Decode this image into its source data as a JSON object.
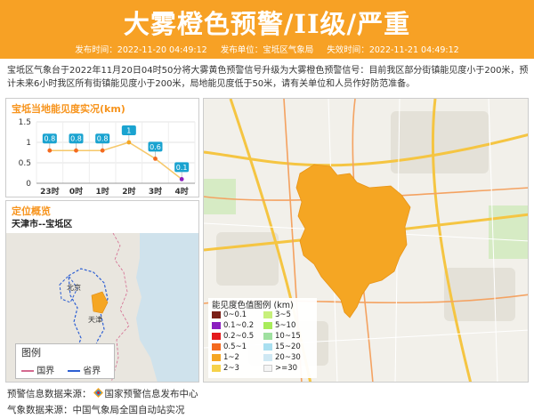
{
  "header": {
    "title": "大雾橙色预警/II级/严重",
    "publish_time_label": "发布时间：",
    "publish_time": "2022-11-20 04:49:12",
    "publisher_label": "发布单位：",
    "publisher": "宝坻区气象局",
    "expire_time_label": "失效时间：",
    "expire_time": "2022-11-21 04:49:12"
  },
  "description": "宝坻区气象台于2022年11月20日04时50分将大雾黄色预警信号升级为大雾橙色预警信号：目前我区部分街镇能见度小于200米，预计未来6小时我区所有街镇能见度小于200米，局地能见度低于50米，请有关单位和人员作好防范准备。",
  "visibility_panel": {
    "title": "宝坻当地能见度实况(km)"
  },
  "location_panel": {
    "title": "定位概览",
    "subtitle": "天津市--宝坻区",
    "map_labels": {
      "beijing": "北京",
      "tianjin": "天津"
    },
    "legend_title": "图例",
    "legend_items": [
      {
        "label": "国界",
        "color": "#d46a8f"
      },
      {
        "label": "省界",
        "color": "#2d5fd3"
      }
    ]
  },
  "visibility_legend": {
    "title": "能见度色值图例 (km)",
    "items": [
      {
        "label": "0~0.1",
        "color": "#7a1f16"
      },
      {
        "label": "3~5",
        "color": "#c7f07a"
      },
      {
        "label": "0.1~0.2",
        "color": "#8b1fbf"
      },
      {
        "label": "5~10",
        "color": "#a8ec5a"
      },
      {
        "label": "0.2~0.5",
        "color": "#e41a1c"
      },
      {
        "label": "10~15",
        "color": "#9fe0a0"
      },
      {
        "label": "0.5~1",
        "color": "#f46a1f"
      },
      {
        "label": "15~20",
        "color": "#a9dff0"
      },
      {
        "label": "1~2",
        "color": "#f5a623"
      },
      {
        "label": "20~30",
        "color": "#cfe8f3"
      },
      {
        "label": "2~3",
        "color": "#f6d24a"
      },
      {
        "label": ">=30",
        "color": "#f4f4f4"
      }
    ]
  },
  "footer": {
    "source1_label": "预警信息数据来源：",
    "source1": "国家预警信息发布中心",
    "source2_label": "气象数据来源：",
    "source2": "中国气象局全国自动站实况"
  },
  "chart_data": {
    "type": "line",
    "title": "宝坻当地能见度实况(km)",
    "categories": [
      "23时",
      "0时",
      "1时",
      "2时",
      "3时",
      "4时"
    ],
    "values": [
      0.8,
      0.8,
      0.8,
      1,
      0.6,
      0.1
    ],
    "value_labels": [
      "0.8",
      "0.8",
      "0.8",
      "1",
      "0.6",
      "0.1"
    ],
    "point_colors": [
      "#f46a1f",
      "#f46a1f",
      "#f46a1f",
      "#f5a623",
      "#f46a1f",
      "#8b1fbf"
    ],
    "y_ticks": [
      "0",
      "0.5",
      "1",
      "1.5"
    ],
    "ylim": [
      0,
      1.5
    ],
    "grid": true,
    "badge_color": "#1aa3d0",
    "line_color": "#f6c86a"
  }
}
